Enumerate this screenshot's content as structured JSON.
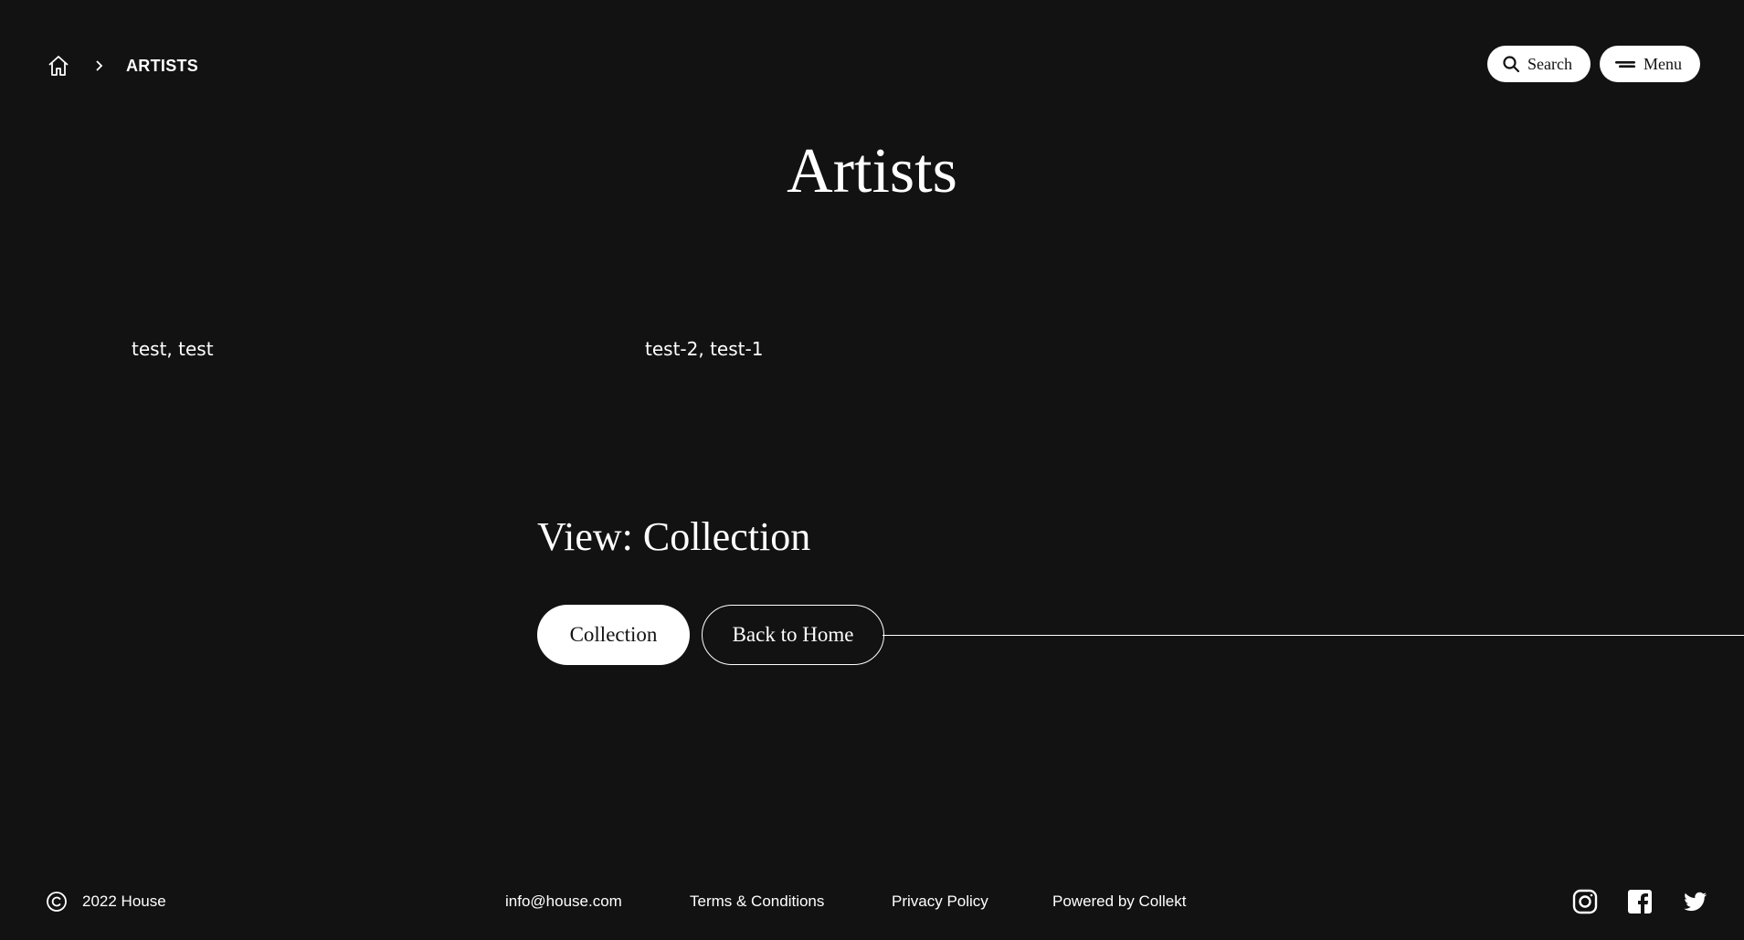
{
  "breadcrumb": {
    "home_icon": "home-icon",
    "separator_icon": "chevron-right-icon",
    "current": "ARTISTS"
  },
  "header": {
    "search_label": "Search",
    "search_icon": "search-icon",
    "menu_label": "Menu",
    "menu_icon": "menu-icon"
  },
  "page_title": "Artists",
  "artists": [
    {
      "name": "test, test"
    },
    {
      "name": "test-2, test-1"
    }
  ],
  "view": {
    "heading": "View: Collection",
    "primary_button": "Collection",
    "secondary_button": "Back to Home"
  },
  "footer": {
    "copyright_icon": "copyright-icon",
    "copyright_text": "2022 House",
    "links": [
      {
        "label": "info@house.com"
      },
      {
        "label": "Terms & Conditions"
      },
      {
        "label": "Privacy Policy"
      },
      {
        "label": "Powered by Collekt"
      }
    ],
    "social_icons": [
      "instagram-icon",
      "facebook-icon",
      "twitter-icon"
    ]
  },
  "colors": {
    "background": "#121212",
    "foreground": "#ffffff"
  }
}
